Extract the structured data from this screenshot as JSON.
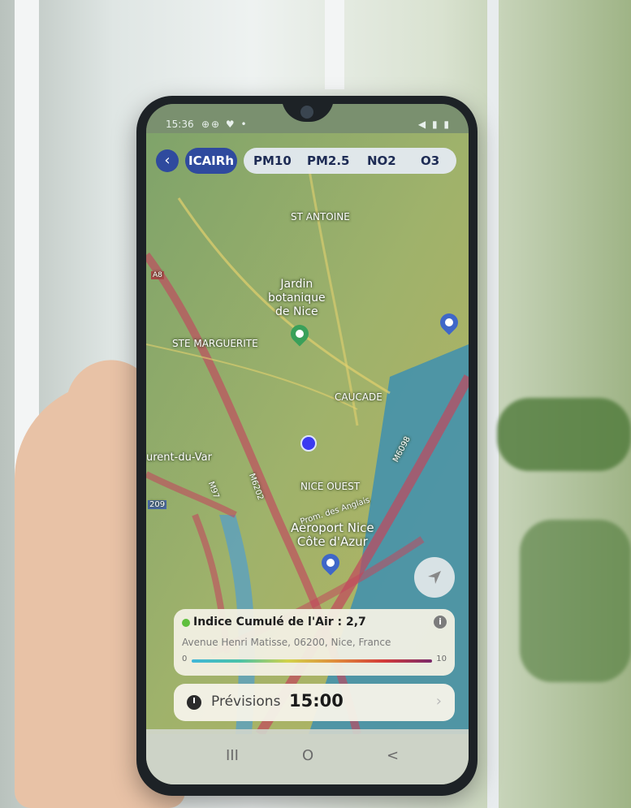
{
  "status_bar": {
    "time": "15:36",
    "icons": "⊕⊕ ♥ •",
    "right_icons": "◀ ▮ ▮"
  },
  "map": {
    "labels": {
      "st_antoine": "ST ANTOINE",
      "ste_marguerite": "STE MARGUERITE",
      "caucade": "CAUCADE",
      "laurent_du_var": "urent-du-Var",
      "nice_ouest": "NICE OUEST",
      "road_a8": "A8",
      "road_m6098": "M6098",
      "road_m6202": "M6202",
      "road_209": "209",
      "road_m97": "M97",
      "prom_des_anglais": "Prom. des Anglais"
    },
    "pois": {
      "jardin": "Jardin\nbotanique\nde Nice",
      "aeroport": "Aeroport Nice\nCôte d'Azur"
    }
  },
  "top_bar": {
    "back_icon": "chevron-left-icon",
    "active_tab": "ICAIRh",
    "pollutants": [
      "PM10",
      "PM2.5",
      "NO2",
      "O3"
    ]
  },
  "index_card": {
    "title": "Indice Cumulé de l'Air : 2,7",
    "address": "Avenue Henri Matisse, 06200, Nice, France",
    "scale_min": "0",
    "scale_max": "10",
    "status_color": "#5fbf3d"
  },
  "forecast": {
    "label": "Prévisions",
    "time": "15:00"
  },
  "nav_bar": {
    "recent": "III",
    "home": "O",
    "back": "<"
  }
}
